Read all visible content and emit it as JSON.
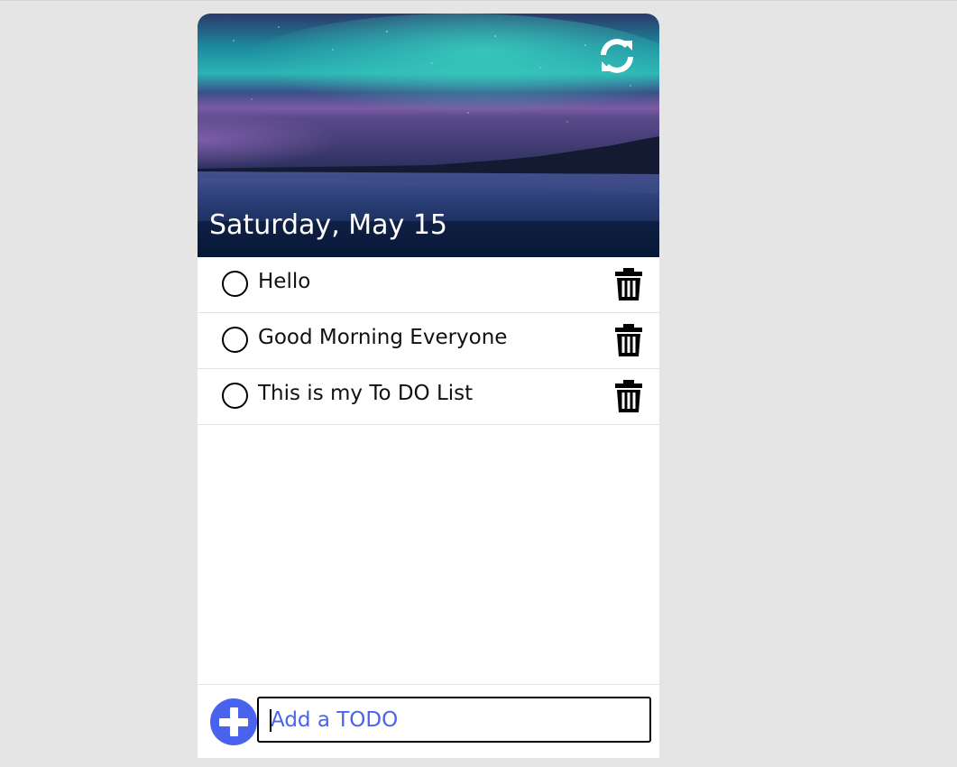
{
  "header": {
    "date": "Saturday, May 15",
    "refresh_icon": "refresh-icon"
  },
  "todos": [
    {
      "text": "Hello",
      "done": false
    },
    {
      "text": "Good Morning Everyone",
      "done": false
    },
    {
      "text": "This is my To DO List",
      "done": false
    }
  ],
  "footer": {
    "add_icon": "plus-icon",
    "input_placeholder": "Add a TODO",
    "input_value": ""
  },
  "colors": {
    "accent": "#4a63ee",
    "background": "#e5e5e5"
  }
}
